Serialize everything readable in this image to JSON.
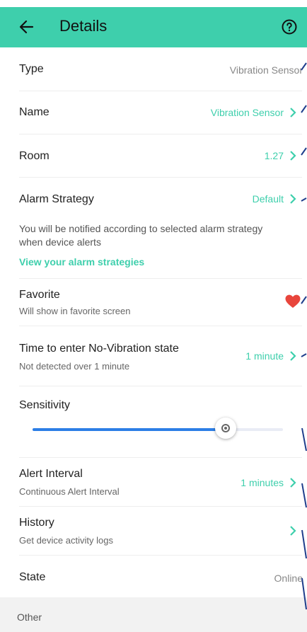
{
  "header": {
    "title": "Details",
    "back_icon": "arrow-left-icon",
    "help_icon": "question-circle-icon",
    "bg": "#3ecfac"
  },
  "rows": {
    "type": {
      "label": "Type",
      "value": "Vibration Sensor"
    },
    "name": {
      "label": "Name",
      "value": "Vibration Sensor"
    },
    "room": {
      "label": "Room",
      "value": "1.27"
    },
    "alarm": {
      "label": "Alarm Strategy",
      "value": "Default",
      "note": "You will be notified according to selected alarm strategy when device alerts",
      "link": "View your alarm strategies"
    },
    "favorite": {
      "label": "Favorite",
      "sub": "Will show in favorite screen",
      "icon": "heart-icon",
      "favorited": true
    },
    "novib": {
      "label": "Time to enter No-Vibration state",
      "sub": "Not detected over 1 minute",
      "value": "1 minute"
    },
    "sensitivity": {
      "label": "Sensitivity",
      "level_percent": 77
    },
    "alert": {
      "label": "Alert Interval",
      "sub": "Continuous Alert Interval",
      "value": "1 minutes"
    },
    "history": {
      "label": "History",
      "sub": "Get device activity logs"
    },
    "state": {
      "label": "State",
      "value": "Online"
    }
  },
  "section_other": "Other",
  "colors": {
    "accent": "#3ecfac",
    "slider": "#2c7ee6",
    "heart": "#e8453c"
  }
}
